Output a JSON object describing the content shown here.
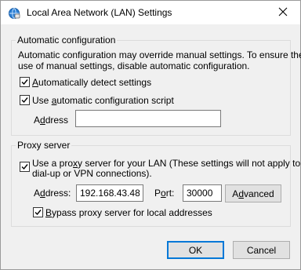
{
  "window": {
    "title": "Local Area Network (LAN) Settings"
  },
  "auto_config": {
    "group_title": "Automatic configuration",
    "description_line1": "Automatic configuration may override manual settings.  To ensure the",
    "description_line2": "use of manual settings, disable automatic configuration.",
    "detect_settings_label": "Automatically detect settings",
    "detect_settings_checked": true,
    "use_script_label": "Use automatic configuration script",
    "use_script_checked": true,
    "address_label": "Address",
    "address_value": ""
  },
  "proxy": {
    "group_title": "Proxy server",
    "use_proxy_line1": "Use a proxy server for your LAN (These settings will not apply to",
    "use_proxy_line2": "dial-up or VPN connections).",
    "use_proxy_checked": true,
    "address_label": "Address:",
    "address_value": "192.168.43.48",
    "port_label": "Port:",
    "port_value": "30000",
    "advanced_label": "Advanced",
    "bypass_label": "Bypass proxy server for local addresses",
    "bypass_checked": true
  },
  "buttons": {
    "ok_label": "OK",
    "cancel_label": "Cancel"
  }
}
